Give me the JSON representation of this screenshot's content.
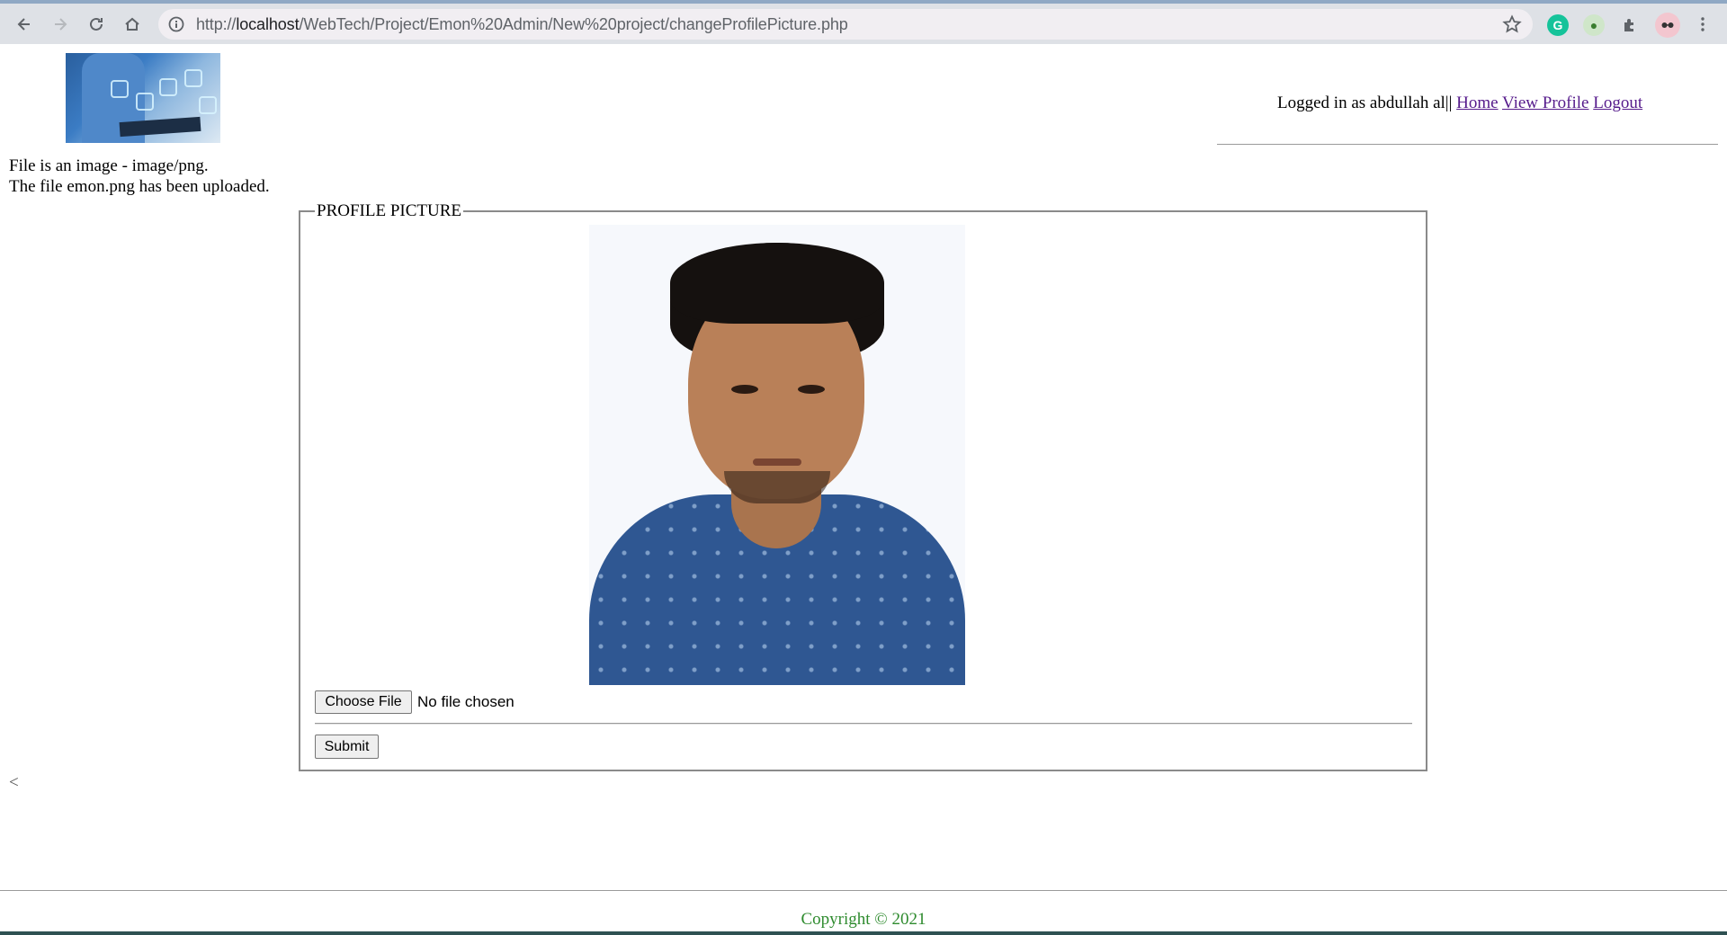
{
  "browser": {
    "url_prefix": "http://",
    "url_host": "localhost",
    "url_path": "/WebTech/Project/Emon%20Admin/New%20project/changeProfilePicture.php",
    "extensions": [
      {
        "icon": "grammarly-icon",
        "glyph": "G",
        "color": "#15c39a"
      },
      {
        "icon": "extension-globe-icon",
        "glyph": "●",
        "color": "#3a7d2f"
      }
    ]
  },
  "header": {
    "logged_in_text": "Logged in as abdullah al||",
    "links": {
      "home": "Home",
      "view_profile": "View Profile",
      "logout": "Logout"
    }
  },
  "messages": {
    "line1": "File is an image - image/png.",
    "line2": "The file emon.png has been uploaded."
  },
  "form": {
    "legend": "PROFILE PICTURE",
    "choose_file_label": "Choose File",
    "file_status": "No file chosen",
    "submit_label": "Submit"
  },
  "stray_text": "<",
  "footer": {
    "copyright": "Copyright © 2021"
  },
  "colors": {
    "link": "#551a8b",
    "copyright": "#2e8b2e"
  }
}
